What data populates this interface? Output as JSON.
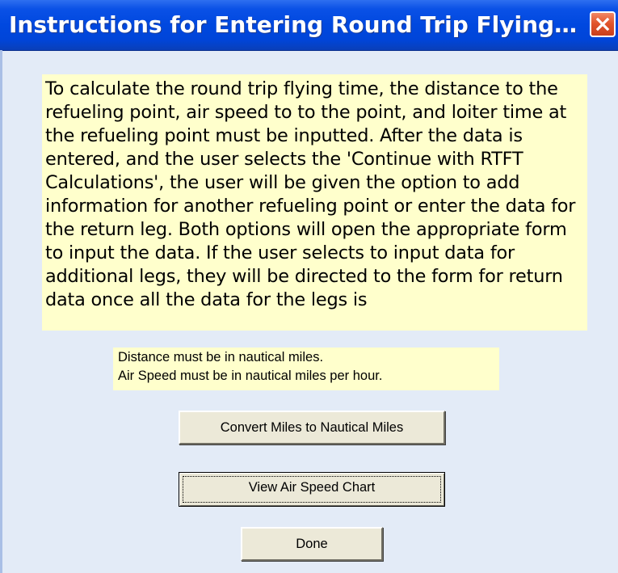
{
  "window": {
    "title": "Instructions for Entering Round Trip Flying T..."
  },
  "instructions": {
    "text": "To calculate the round trip flying time, the distance to the refueling point, air speed to to the point, and loiter time at the refueling point must be inputted.  After the data is entered, and the user selects the 'Continue with RTFT Calculations', the user will be given the option to add information for another refueling point or enter the data for the return leg.  Both options will open the appropriate form to input the data.  If the user selects to input data for additional legs, they will be directed to the form for return data once all the data for the legs is"
  },
  "notes": {
    "distance": "Distance must be in nautical miles.",
    "air_speed": "Air Speed must be in nautical miles per hour."
  },
  "buttons": {
    "convert": "Convert Miles to Nautical Miles",
    "chart": "View Air Speed Chart",
    "done": "Done"
  },
  "colors": {
    "titlebar": "#0048df",
    "body": "#e3ebf7",
    "note_background": "#ffffcc",
    "button_face": "#ece9d8",
    "close_button": "#e2552c"
  },
  "icons": {
    "close": "close-icon"
  }
}
